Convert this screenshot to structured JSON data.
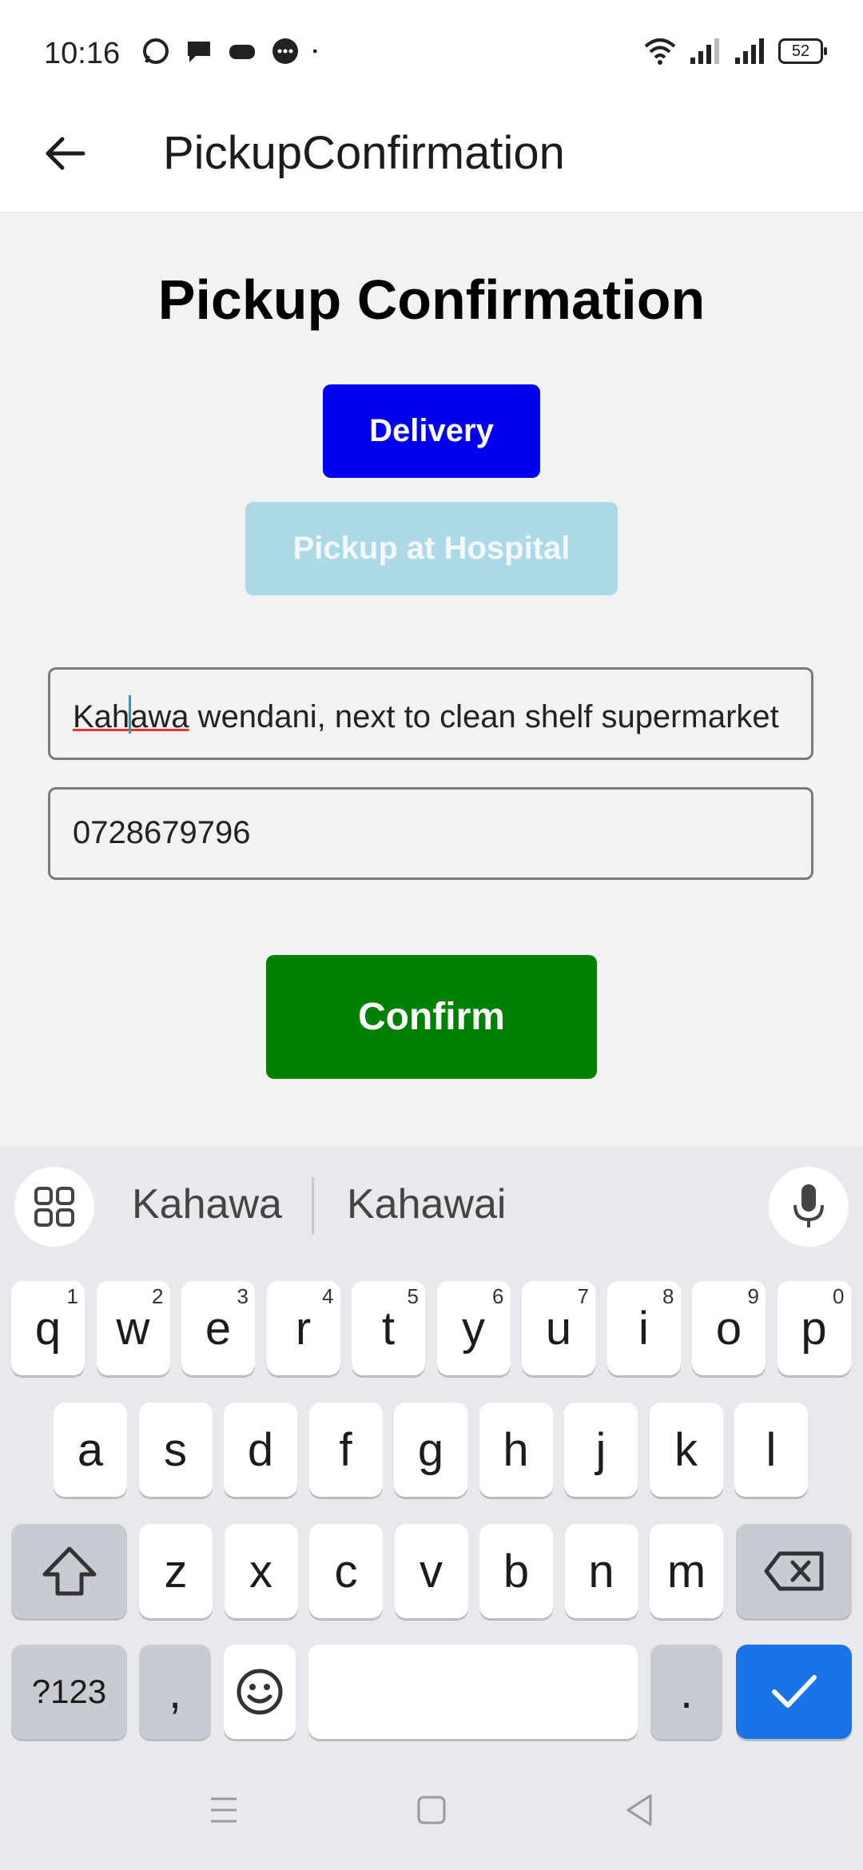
{
  "status_bar": {
    "time": "10:16",
    "battery": "52"
  },
  "app_bar": {
    "title": "PickupConfirmation"
  },
  "page": {
    "heading": "Pickup Confirmation",
    "delivery_label": "Delivery",
    "pickup_label": "Pickup at Hospital",
    "address": {
      "before_cursor": "Kah",
      "after_cursor": "awa",
      "rest": " wendani, next to clean shelf supermarket"
    },
    "phone": "0728679796",
    "confirm_label": "Confirm"
  },
  "colors": {
    "delivery": "#0000ee",
    "pickup": "#add8e6",
    "confirm": "#008000",
    "keyboard_action": "#1a73e8"
  },
  "keyboard": {
    "suggestions": [
      "Kahawa",
      "Kahawai"
    ],
    "row1": [
      {
        "k": "q",
        "n": "1"
      },
      {
        "k": "w",
        "n": "2"
      },
      {
        "k": "e",
        "n": "3"
      },
      {
        "k": "r",
        "n": "4"
      },
      {
        "k": "t",
        "n": "5"
      },
      {
        "k": "y",
        "n": "6"
      },
      {
        "k": "u",
        "n": "7"
      },
      {
        "k": "i",
        "n": "8"
      },
      {
        "k": "o",
        "n": "9"
      },
      {
        "k": "p",
        "n": "0"
      }
    ],
    "row2": [
      "a",
      "s",
      "d",
      "f",
      "g",
      "h",
      "j",
      "k",
      "l"
    ],
    "row3": [
      "z",
      "x",
      "c",
      "v",
      "b",
      "n",
      "m"
    ],
    "symbols": "?123",
    "comma": ",",
    "period": "."
  }
}
